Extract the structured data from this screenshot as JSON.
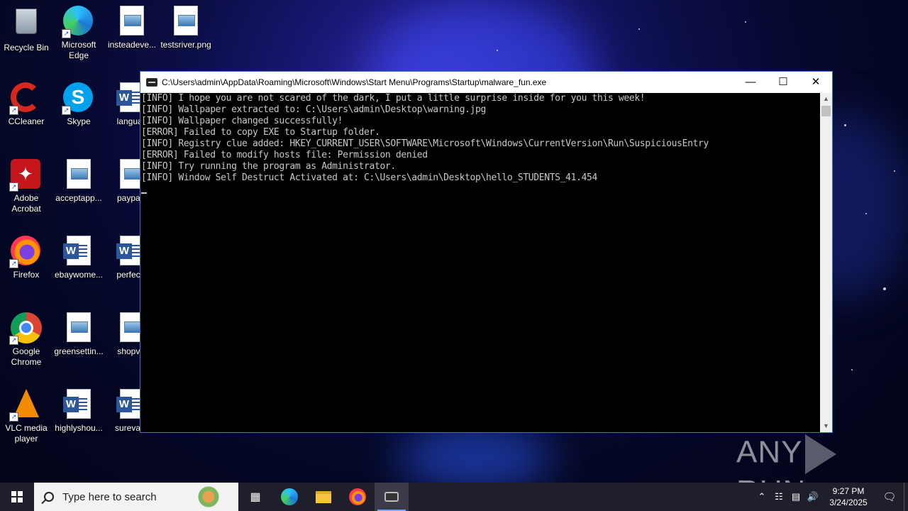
{
  "desktop": {
    "icons": [
      {
        "label": "Recycle Bin",
        "icon": "recycle-bin-icon"
      },
      {
        "label": "Microsoft Edge",
        "icon": "edge-icon"
      },
      {
        "label": "insteadeve...",
        "icon": "image-file-icon"
      },
      {
        "label": "testsriver.png",
        "icon": "image-file-icon"
      },
      {
        "label": "CCleaner",
        "icon": "ccleaner-icon"
      },
      {
        "label": "Skype",
        "icon": "skype-icon"
      },
      {
        "label": "languag",
        "icon": "word-doc-icon"
      },
      {
        "label": "Adobe Acrobat",
        "icon": "acrobat-icon"
      },
      {
        "label": "acceptapp...",
        "icon": "image-file-icon"
      },
      {
        "label": "paypalg",
        "icon": "image-file-icon"
      },
      {
        "label": "Firefox",
        "icon": "firefox-icon"
      },
      {
        "label": "ebaywome...",
        "icon": "word-doc-icon"
      },
      {
        "label": "perfecto",
        "icon": "word-doc-icon"
      },
      {
        "label": "Google Chrome",
        "icon": "chrome-icon"
      },
      {
        "label": "greensettin...",
        "icon": "image-file-icon"
      },
      {
        "label": "shopvid",
        "icon": "image-file-icon"
      },
      {
        "label": "VLC media player",
        "icon": "vlc-icon"
      },
      {
        "label": "highlyshou...",
        "icon": "word-doc-icon"
      },
      {
        "label": "surevalle",
        "icon": "word-doc-icon"
      }
    ]
  },
  "console": {
    "title": "C:\\Users\\admin\\AppData\\Roaming\\Microsoft\\Windows\\Start Menu\\Programs\\Startup\\malware_fun.exe",
    "lines": [
      "[INFO] I hope you are not scared of the dark, I put a little surprise inside for you this week!",
      "[INFO] Wallpaper extracted to: C:\\Users\\admin\\Desktop\\warning.jpg",
      "[INFO] Wallpaper changed successfully!",
      "[ERROR] Failed to copy EXE to Startup folder.",
      "[INFO] Registry clue added: HKEY_CURRENT_USER\\SOFTWARE\\Microsoft\\Windows\\CurrentVersion\\Run\\SuspiciousEntry",
      "[ERROR] Failed to modify hosts file: Permission denied",
      "[INFO] Try running the program as Administrator.",
      "[INFO] Window Self Destruct Activated at: C:\\Users\\admin\\Desktop\\hello_STUDENTS_41.454"
    ]
  },
  "watermark": {
    "left": "ANY",
    "right": "RUN"
  },
  "taskbar": {
    "search_placeholder": "Type here to search",
    "apps": [
      "task-view-icon",
      "edge-icon",
      "file-explorer-icon",
      "firefox-icon",
      "console-app-icon"
    ],
    "time": "9:27 PM",
    "date": "3/24/2025"
  }
}
